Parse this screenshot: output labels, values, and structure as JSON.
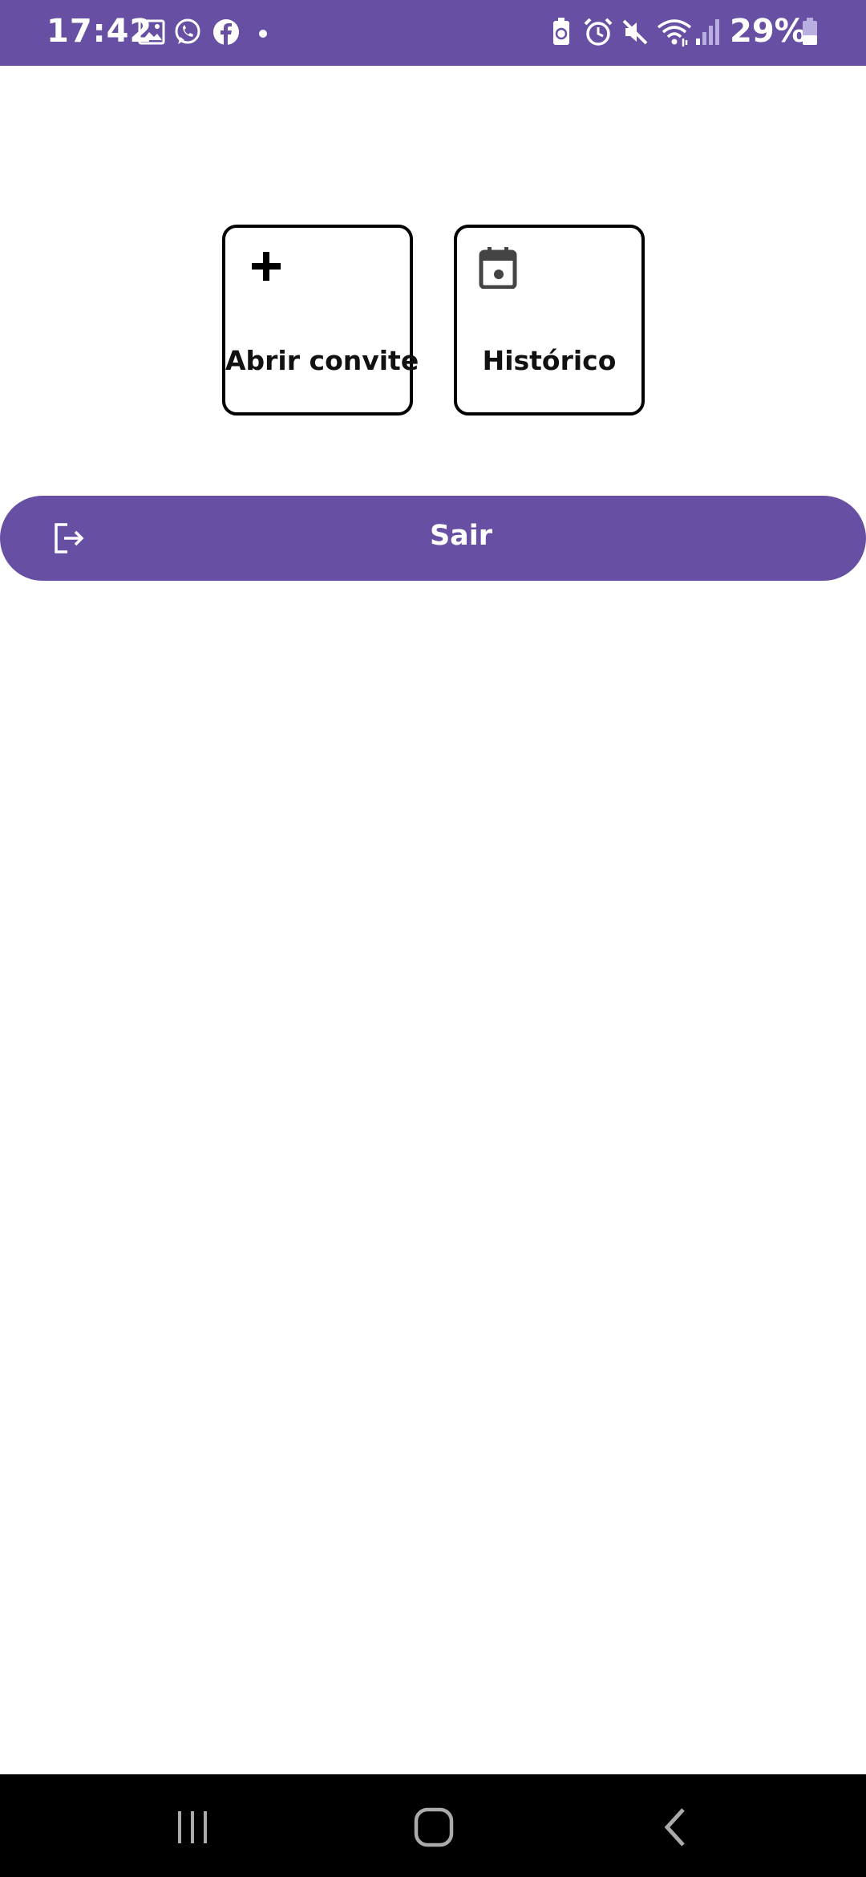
{
  "status_bar": {
    "time": "17:42",
    "battery_text": "29%",
    "background_color": "#6750A4",
    "left_icons": [
      "gallery-icon",
      "whatsapp-icon",
      "facebook-icon",
      "notification-dot-icon"
    ],
    "right_icons": [
      "battery-saver-icon",
      "alarm-icon",
      "mute-icon",
      "wifi-icon",
      "signal-icon",
      "battery-icon"
    ]
  },
  "main": {
    "tiles": [
      {
        "label": "Abrir convite",
        "icon": "plus-icon"
      },
      {
        "label": "Histórico",
        "icon": "calendar-icon"
      }
    ],
    "logout": {
      "label": "Sair",
      "icon": "logout-icon",
      "color": "#6750A4"
    }
  },
  "nav_bar": {
    "buttons": [
      "recents-icon",
      "home-icon",
      "back-icon"
    ]
  }
}
